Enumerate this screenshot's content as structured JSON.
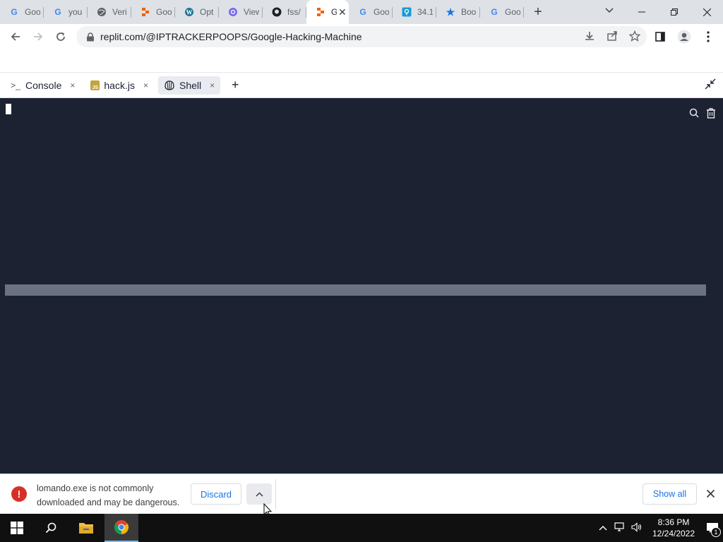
{
  "browser": {
    "tabs": [
      {
        "title": "Goo",
        "icon": "google-icon"
      },
      {
        "title": "you",
        "icon": "google-icon"
      },
      {
        "title": "Veri",
        "icon": "globe-icon"
      },
      {
        "title": "Goo",
        "icon": "replit-icon"
      },
      {
        "title": "Opt",
        "icon": "wordpress-icon"
      },
      {
        "title": "View",
        "icon": "at-icon"
      },
      {
        "title": "fss/",
        "icon": "github-icon"
      },
      {
        "title": "G",
        "icon": "replit-icon",
        "active": true
      },
      {
        "title": "Goo",
        "icon": "google-icon"
      },
      {
        "title": "34.1",
        "icon": "location-icon"
      },
      {
        "title": "Boo",
        "icon": "star-icon"
      },
      {
        "title": "Goo",
        "icon": "google-icon"
      }
    ],
    "new_tab_label": "+",
    "address": "replit.com/@IPTRACKERPOOPS/Google-Hacking-Machine"
  },
  "replit": {
    "tabs": [
      {
        "label": "Console",
        "icon": "console-icon"
      },
      {
        "label": "hack.js",
        "icon": "js-file-icon"
      },
      {
        "label": "Shell",
        "icon": "shell-icon",
        "active": true
      }
    ],
    "close_glyph": "×",
    "add_label": "+"
  },
  "download_bar": {
    "message": "lomando.exe is not commonly downloaded and may be dangerous.",
    "discard_label": "Discard",
    "show_all_label": "Show all",
    "warning_glyph": "!"
  },
  "taskbar": {
    "time": "8:36 PM",
    "date": "12/24/2022",
    "notification_count": "1"
  },
  "colors": {
    "terminal_bg": "#1c2232",
    "accent": "#1a73e8",
    "warning": "#d93025"
  }
}
